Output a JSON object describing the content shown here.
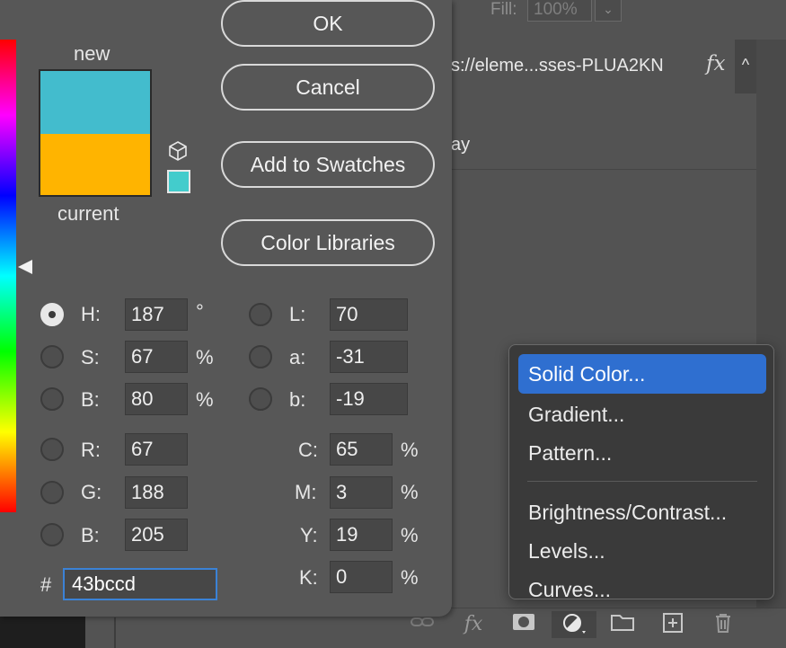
{
  "background": {
    "fill_label": "Fill:",
    "fill_value": "100%",
    "fill_arrow": "⌄",
    "layer_name": "s://eleme...sses-PLUA2KN",
    "layer_fx": "fx",
    "layer_chevron": "^",
    "layer_sub": "ay",
    "bottom_icons": [
      "link-icon",
      "fx-icon",
      "mask-icon",
      "adjustment-icon",
      "folder-icon",
      "new-layer-icon",
      "trash-icon"
    ],
    "bottom_fx": "fx"
  },
  "dialog": {
    "label_new": "new",
    "label_current": "current",
    "new_color": "#43bccd",
    "current_color": "#ffb400",
    "websafe_color": "#43cccc",
    "buttons": {
      "ok": "OK",
      "cancel": "Cancel",
      "add_to_swatches": "Add to Swatches",
      "color_libraries": "Color Libraries"
    },
    "hsb": {
      "h_label": "H:",
      "h_value": "187",
      "h_unit": "°",
      "s_label": "S:",
      "s_value": "67",
      "s_unit": "%",
      "b_label": "B:",
      "b_value": "80",
      "b_unit": "%"
    },
    "lab": {
      "l_label": "L:",
      "l_value": "70",
      "a_label": "a:",
      "a_value": "-31",
      "b_label": "b:",
      "b_value": "-19"
    },
    "rgb": {
      "r_label": "R:",
      "r_value": "67",
      "g_label": "G:",
      "g_value": "188",
      "b_label": "B:",
      "b_value": "205"
    },
    "cmyk": {
      "c_label": "C:",
      "c_value": "65",
      "c_unit": "%",
      "m_label": "M:",
      "m_value": "3",
      "m_unit": "%",
      "y_label": "Y:",
      "y_value": "19",
      "y_unit": "%",
      "k_label": "K:",
      "k_value": "0",
      "k_unit": "%"
    },
    "hex_label": "#",
    "hex_value": "43bccd"
  },
  "menu": {
    "items": [
      "Solid Color...",
      "Gradient...",
      "Pattern...",
      "Brightness/Contrast...",
      "Levels...",
      "Curves..."
    ],
    "selected": "Solid Color...",
    "accent": "#2f6fd0"
  }
}
